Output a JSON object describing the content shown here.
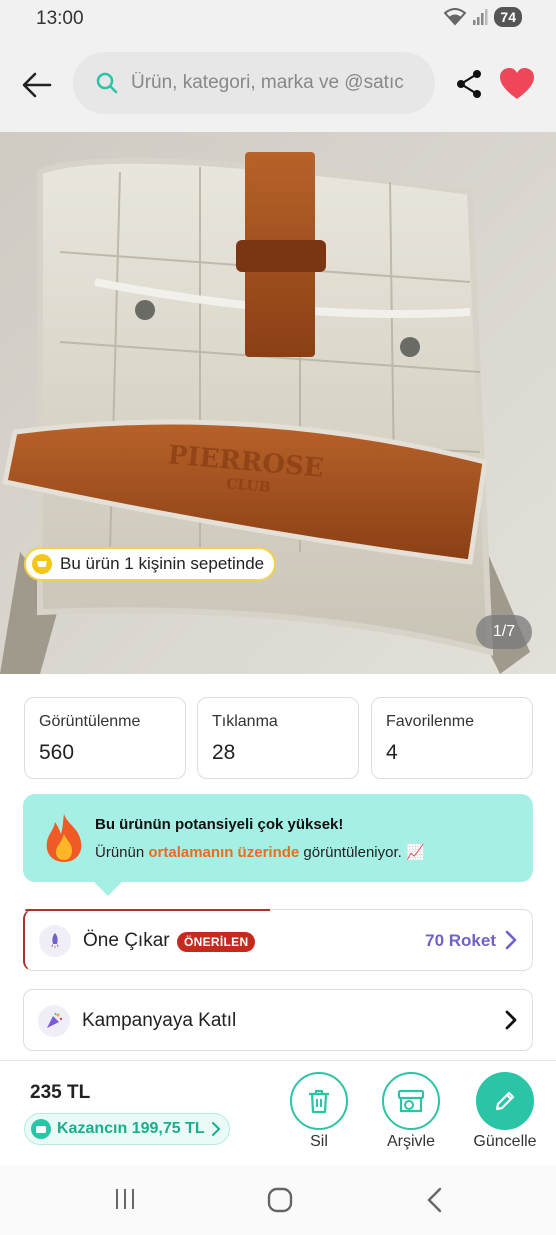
{
  "status_bar": {
    "time": "13:00",
    "battery": "74"
  },
  "search": {
    "placeholder": "Ürün, kategori, marka ve @satıc"
  },
  "product": {
    "image_description": "quilted beige bag with brown leather straps",
    "basket_badge": "Bu ürün 1 kişinin sepetinde",
    "page_counter": "1/7"
  },
  "stats": [
    {
      "label": "Görüntülenme",
      "value": "560"
    },
    {
      "label": "Tıklanma",
      "value": "28"
    },
    {
      "label": "Favorilenme",
      "value": "4"
    }
  ],
  "potential": {
    "title": "Bu ürünün potansiyeli çok yüksek!",
    "text_before": "Ürünün ",
    "highlight": "ortalamanın üzerinde",
    "text_after": " görüntüleniyor. 📈"
  },
  "feature_row": {
    "label": "Öne Çıkar",
    "badge": "ÖNERİLEN",
    "price": "70 Roket"
  },
  "campaign_row": {
    "label": "Kampanyaya Katıl"
  },
  "bottom": {
    "price": "235 TL",
    "earnings": "Kazancın 199,75 TL",
    "delete_label": "Sil",
    "archive_label": "Arşivle",
    "update_label": "Güncelle"
  },
  "colors": {
    "accent": "#2bc4a6",
    "banner_bg": "#a6efe4",
    "highlight": "#f26a1b",
    "roket": "#6f62c9",
    "badge_red": "#c42b1c",
    "heart": "#f0465a"
  }
}
